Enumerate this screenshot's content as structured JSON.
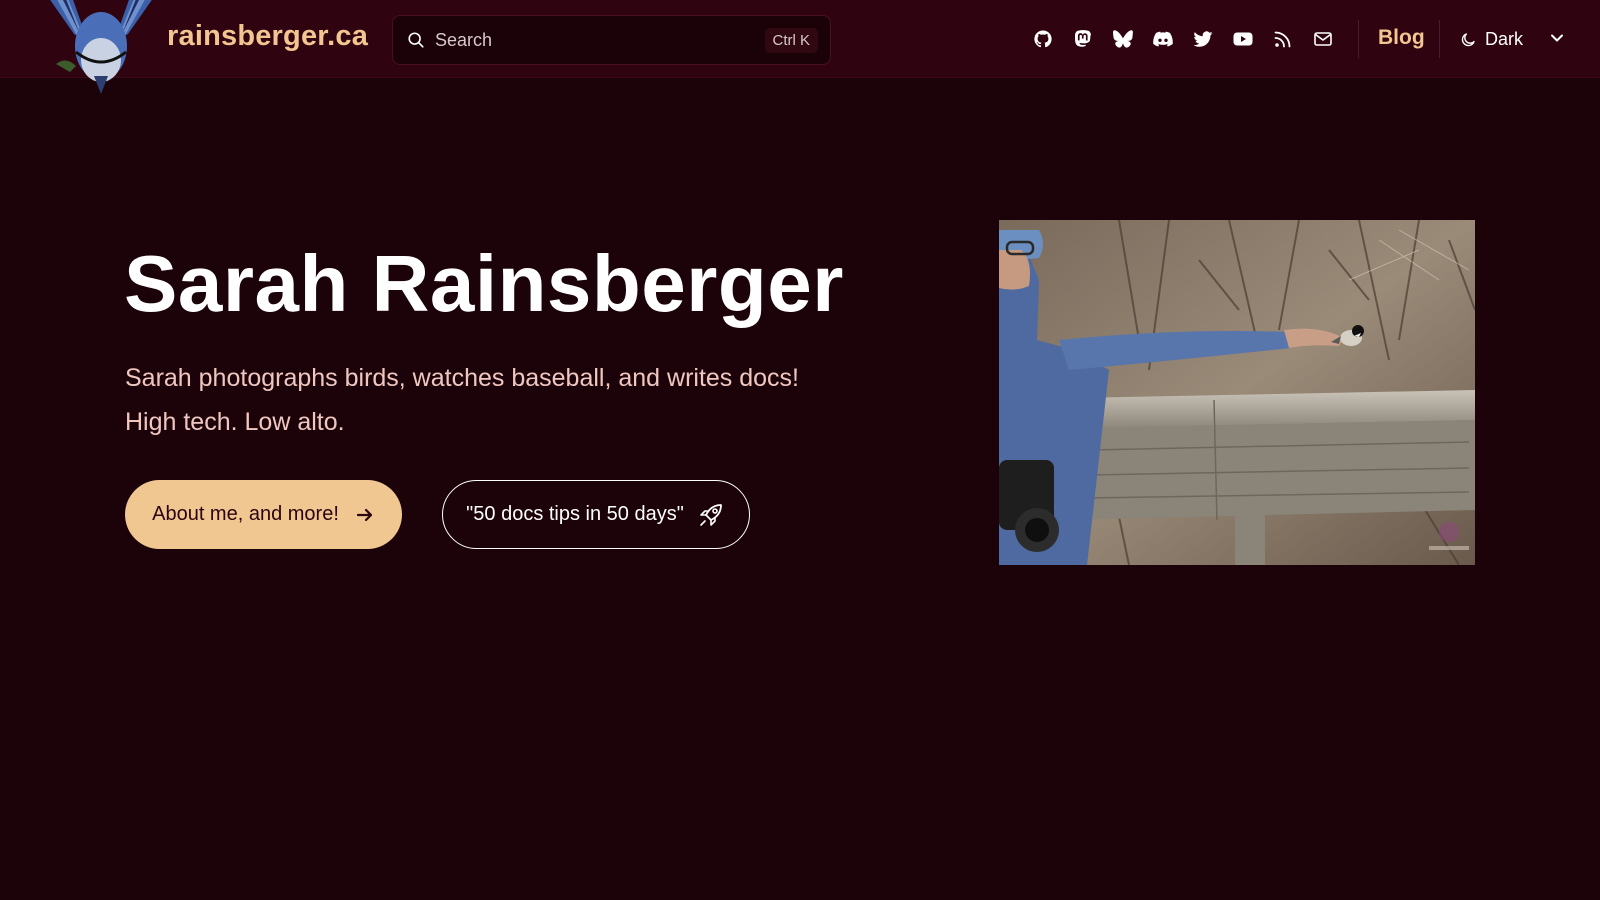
{
  "header": {
    "site_title": "rainsberger.ca",
    "search": {
      "placeholder": "Search",
      "shortcut": "Ctrl K"
    },
    "social_icons": [
      "github-icon",
      "mastodon-icon",
      "bluesky-icon",
      "discord-icon",
      "twitter-icon",
      "youtube-icon",
      "rss-icon",
      "email-icon"
    ],
    "blog_label": "Blog",
    "theme_label": "Dark"
  },
  "hero": {
    "title": "Sarah Rainsberger",
    "tagline_line1": "Sarah photographs birds, watches baseball, and writes docs!",
    "tagline_line2": "High tech. Low alto.",
    "primary_button": "About me, and more!",
    "secondary_button": "\"50 docs tips in 50 days\""
  },
  "colors": {
    "background": "#1b0309",
    "navbar": "#2f0410",
    "accent": "#f1c791",
    "tagline": "#f0c7c0"
  }
}
